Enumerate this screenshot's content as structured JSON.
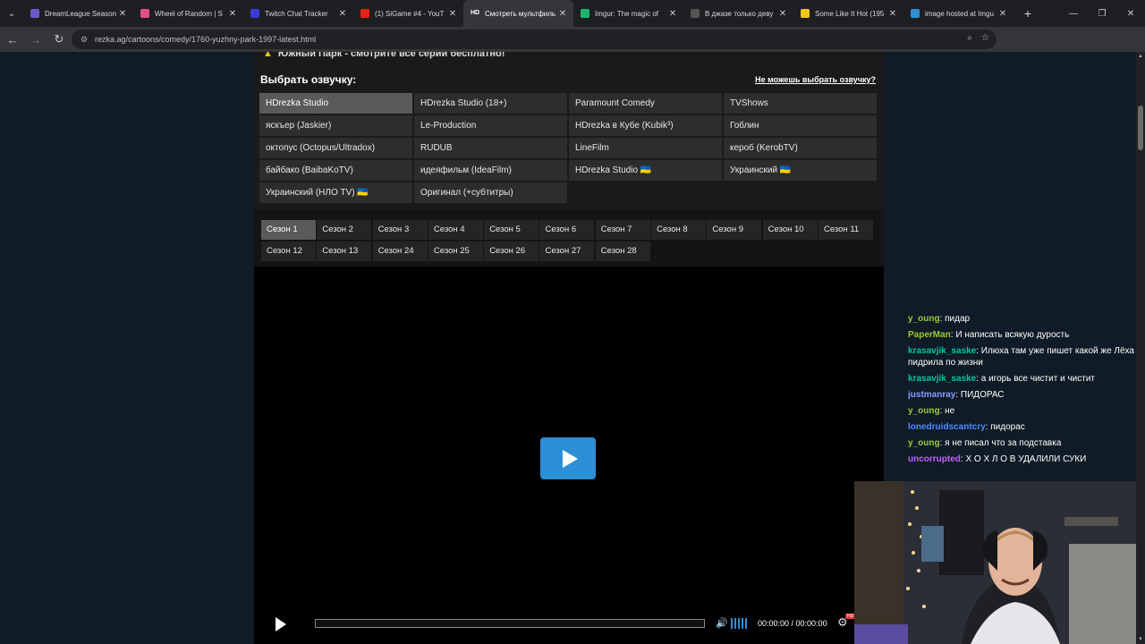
{
  "browser": {
    "tabs": [
      {
        "title": "DreamLeague Season",
        "favicon_color": "#6a5acd",
        "favicon_char": "",
        "active": false
      },
      {
        "title": "Wheel of Random | S",
        "favicon_color": "#e0508a",
        "favicon_char": "",
        "active": false
      },
      {
        "title": "Twitch Chat Tracker",
        "favicon_color": "#3b3bd8",
        "favicon_char": "",
        "active": false
      },
      {
        "title": "(1) SiGame #4 - YouT",
        "favicon_color": "#e62117",
        "favicon_char": "",
        "active": false
      },
      {
        "title": "Смотреть мультфиль",
        "favicon_color": "#35363a",
        "favicon_char": "HD",
        "active": true
      },
      {
        "title": "Imgur: The magic of",
        "favicon_color": "#1bb76e",
        "favicon_char": "",
        "active": false
      },
      {
        "title": "В джазе только деву",
        "favicon_color": "#555555",
        "favicon_char": "",
        "active": false
      },
      {
        "title": "Some Like It Hot (195",
        "favicon_color": "#f5c518",
        "favicon_char": "",
        "active": false
      },
      {
        "title": "image hosted at Imgu",
        "favicon_color": "#2d8fd6",
        "favicon_char": "",
        "active": false
      }
    ],
    "url": "rezka.ag/cartoons/comedy/1760-yuzhny-park-1997-latest.html"
  },
  "page": {
    "warning_text": "Южный Парк - смотрите все серии бесплатно!",
    "dub_label": "Выбрать озвучку:",
    "dub_help": "Не можешь выбрать озвучку?",
    "dubbings": [
      {
        "label": "HDrezka Studio",
        "active": true
      },
      {
        "label": "HDrezka Studio (18+)",
        "active": false
      },
      {
        "label": "Paramount Comedy",
        "active": false
      },
      {
        "label": "TVShows",
        "active": false
      },
      {
        "label": "яскъер (Jaskier)",
        "active": false
      },
      {
        "label": "Le-Production",
        "active": false
      },
      {
        "label": "HDrezka в Кубе (Kubik³)",
        "active": false
      },
      {
        "label": "Гоблин",
        "active": false
      },
      {
        "label": "октопус (Octopus/Ultradox)",
        "active": false
      },
      {
        "label": "RUDUB",
        "active": false
      },
      {
        "label": "LineFilm",
        "active": false
      },
      {
        "label": "кероб (KerobTV)",
        "active": false
      },
      {
        "label": "байбако (BaibaKoTV)",
        "active": false
      },
      {
        "label": "идеяфильм (IdeaFilm)",
        "active": false
      },
      {
        "label": "HDrezka Studio 🇺🇦",
        "active": false
      },
      {
        "label": "Украинский 🇺🇦",
        "active": false
      },
      {
        "label": "Украинский (НЛО TV) 🇺🇦",
        "active": false
      },
      {
        "label": "Оригинал (+субтитры)",
        "active": false
      }
    ],
    "seasons": [
      {
        "label": "Сезон 1",
        "active": true
      },
      {
        "label": "Сезон 2",
        "active": false
      },
      {
        "label": "Сезон 3",
        "active": false
      },
      {
        "label": "Сезон 4",
        "active": false
      },
      {
        "label": "Сезон 5",
        "active": false
      },
      {
        "label": "Сезон 6",
        "active": false
      },
      {
        "label": "Сезон 7",
        "active": false
      },
      {
        "label": "Сезон 8",
        "active": false
      },
      {
        "label": "Сезон 9",
        "active": false
      },
      {
        "label": "Сезон 10",
        "active": false
      },
      {
        "label": "Сезон 11",
        "active": false
      },
      {
        "label": "Сезон 12",
        "active": false
      },
      {
        "label": "Сезон 13",
        "active": false
      },
      {
        "label": "Сезон 24",
        "active": false
      },
      {
        "label": "Сезон 25",
        "active": false
      },
      {
        "label": "Сезон 26",
        "active": false
      },
      {
        "label": "Сезон 27",
        "active": false
      },
      {
        "label": "Сезон 28",
        "active": false
      }
    ],
    "player": {
      "time": "00:00:00 / 00:00:00",
      "accent": "#2d8fd6"
    }
  },
  "chat": [
    {
      "user": "y_oung",
      "color": "#9acd32",
      "text": "пидар"
    },
    {
      "user": "PaperMan",
      "color": "#9acd32",
      "text": "И написать всякую дурость"
    },
    {
      "user": "krasavjik_saske",
      "color": "#00c8a0",
      "text": "Илюха там уже пишет какой же Лёха пидрила по жизни"
    },
    {
      "user": "krasavjik_saske",
      "color": "#00c8a0",
      "text": "а игорь все чистит и чистит"
    },
    {
      "user": "justmanray",
      "color": "#8a9aff",
      "text": "ПИДОРАС"
    },
    {
      "user": "y_oung",
      "color": "#9acd32",
      "text": "не"
    },
    {
      "user": "lonedruidscantcry",
      "color": "#4b8cff",
      "text": "пидорас"
    },
    {
      "user": "y_oung",
      "color": "#9acd32",
      "text": "я не писал что за подставка"
    },
    {
      "user": "uncorrupted",
      "color": "#c060ff",
      "text": "Х О Х Л О В УДАЛИЛИ СУКИ"
    }
  ]
}
